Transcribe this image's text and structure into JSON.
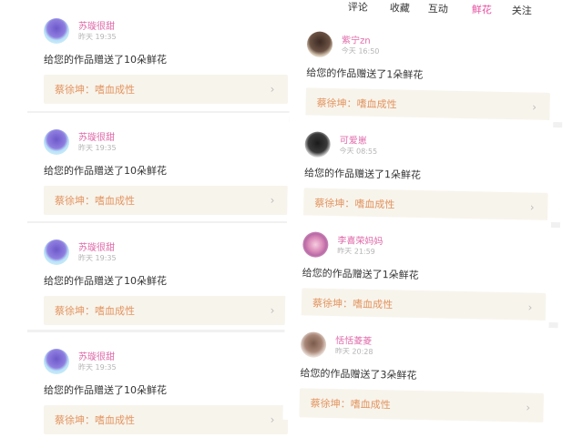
{
  "tabs": [
    {
      "label": "评论",
      "active": false
    },
    {
      "label": "收藏",
      "active": false
    },
    {
      "label": "互动",
      "active": false
    },
    {
      "label": "鲜花",
      "active": true
    },
    {
      "label": "关注",
      "active": false
    }
  ],
  "left_feed": [
    {
      "name": "苏璇很甜",
      "time": "昨天 19:35",
      "message": "给您的作品赠送了10朵鲜花",
      "work_title": "蔡徐坤：嗜血成性"
    },
    {
      "name": "苏璇很甜",
      "time": "昨天 19:35",
      "message": "给您的作品赠送了10朵鲜花",
      "work_title": "蔡徐坤：嗜血成性"
    },
    {
      "name": "苏璇很甜",
      "time": "昨天 19:35",
      "message": "给您的作品赠送了10朵鲜花",
      "work_title": "蔡徐坤：嗜血成性"
    },
    {
      "name": "苏璇很甜",
      "time": "昨天 19:35",
      "message": "给您的作品赠送了10朵鲜花",
      "work_title": "蔡徐坤：嗜血成性"
    }
  ],
  "right_feed": [
    {
      "name": "紫宁zn",
      "time": "今天 16:50",
      "message": "给您的作品赠送了1朵鲜花",
      "work_title": "蔡徐坤：嗜血成性"
    },
    {
      "name": "可爱崽",
      "time": "今天 08:55",
      "message": "给您的作品赠送了1朵鲜花",
      "work_title": "蔡徐坤：嗜血成性"
    },
    {
      "name": "李喜荣妈妈",
      "time": "昨天 21:59",
      "message": "给您的作品赠送了1朵鲜花",
      "work_title": "蔡徐坤：嗜血成性"
    },
    {
      "name": "恬恬菱菱",
      "time": "昨天 20:28",
      "message": "给您的作品赠送了3朵鲜花",
      "work_title": "蔡徐坤：嗜血成性"
    }
  ],
  "chevron_icon": "chevron-right-icon",
  "colors": {
    "name": "#e06aa9",
    "work_title": "#e3945f",
    "work_bg": "#f7f4ec",
    "tab_active": "#e64fa0"
  }
}
